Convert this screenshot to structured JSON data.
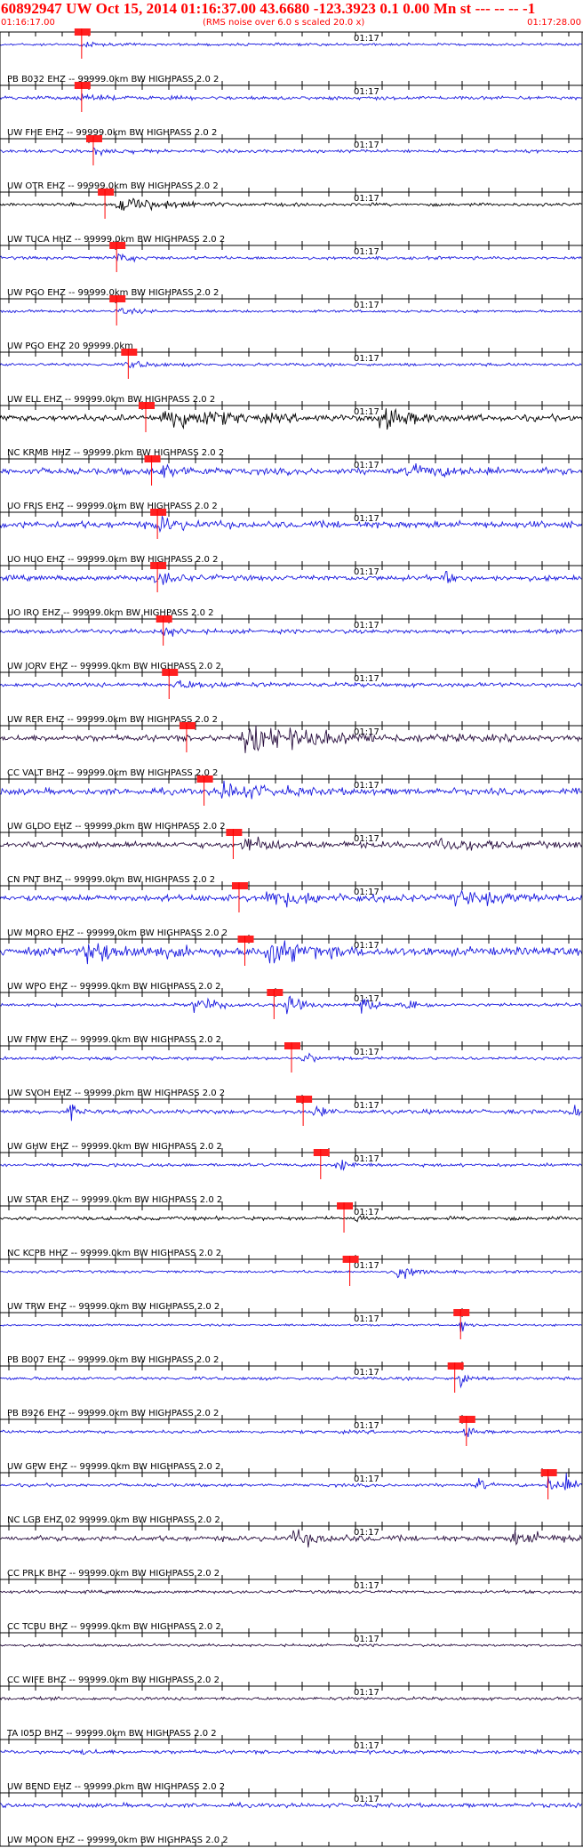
{
  "header": {
    "title": "60892947 UW Oct 15, 2014 01:16:37.00   43.6680 -123.3923  0.1 0.00 Mn st --- -- --  -1",
    "start_time": "01:16:17.00",
    "noise_note": "(RMS noise over 6.0 s scaled 20.0 x)",
    "end_time": "01:17:28.00"
  },
  "colors": {
    "blue": "#1a1adf",
    "black": "#000000",
    "dark": "#2a1040",
    "red": "#ff0000",
    "pick_box": "#ff2020",
    "axis": "#000000"
  },
  "chart_data": {
    "type": "line",
    "title": "60892947 UW Oct 15, 2014 01:16:37.00",
    "x_start": "01:16:17.00",
    "x_end": "01:17:28.00",
    "minute_label": "01:17",
    "traces": [
      {
        "label": "PB B032 EHZ -- 99999.0km BW  HIGHPASS  2.0  2",
        "color": "blue",
        "amp": 0.25,
        "pick": 0.14,
        "events": [
          [
            0.14,
            0.5,
            0.02
          ]
        ]
      },
      {
        "label": "UW FHE EHZ -- 99999.0km BW  HIGHPASS  2.0  2",
        "color": "blue",
        "amp": 0.35,
        "pick": 0.14,
        "events": [
          [
            0.14,
            0.6,
            0.03
          ]
        ]
      },
      {
        "label": "UW OTR EHZ -- 99999.0km BW  HIGHPASS  2.0  2",
        "color": "blue",
        "amp": 0.3,
        "pick": 0.16,
        "events": [
          [
            0.16,
            0.7,
            0.04
          ]
        ]
      },
      {
        "label": "UW TUCA HHZ -- 99999.0km BW  HIGHPASS  2.0  2",
        "color": "black",
        "amp": 0.3,
        "pick": 0.18,
        "events": [
          [
            0.2,
            1.4,
            0.08
          ]
        ]
      },
      {
        "label": "UW PGO EHZ -- 99999.0km BW  HIGHPASS  2.0  2",
        "color": "blue",
        "amp": 0.3,
        "pick": 0.2,
        "events": [
          [
            0.2,
            0.8,
            0.03
          ]
        ]
      },
      {
        "label": "UW PGO EHZ 20 99999.0km",
        "color": "blue",
        "amp": 0.25,
        "pick": 0.2,
        "events": [
          [
            0.2,
            0.6,
            0.03
          ]
        ]
      },
      {
        "label": "UW ELL EHZ -- 99999.0km BW  HIGHPASS  2.0  2",
        "color": "blue",
        "amp": 0.3,
        "pick": 0.22,
        "events": [
          [
            0.22,
            0.8,
            0.03
          ]
        ]
      },
      {
        "label": "NC KRMB HHZ -- 99999.0km BW  HIGHPASS  2.0  2",
        "color": "black",
        "amp": 0.6,
        "pick": 0.25,
        "events": [
          [
            0.28,
            2.6,
            0.08
          ],
          [
            0.65,
            2.0,
            0.05
          ]
        ]
      },
      {
        "label": "UO FRIS EHZ -- 99999.0km BW  HIGHPASS  2.0  2",
        "color": "blue",
        "amp": 0.6,
        "pick": 0.26,
        "events": [
          [
            0.27,
            1.4,
            0.04
          ],
          [
            0.7,
            0.8,
            0.1
          ]
        ]
      },
      {
        "label": "UO HUO EHZ -- 99999.0km BW  HIGHPASS  2.0  2",
        "color": "blue",
        "amp": 0.65,
        "pick": 0.27,
        "events": [
          [
            0.27,
            1.6,
            0.03
          ]
        ]
      },
      {
        "label": "UO IRO EHZ -- 99999.0km BW  HIGHPASS  2.0  2",
        "color": "blue",
        "amp": 0.5,
        "pick": 0.27,
        "events": [
          [
            0.27,
            1.5,
            0.03
          ],
          [
            0.76,
            1.5,
            0.01
          ]
        ]
      },
      {
        "label": "UW JORV EHZ -- 99999.0km BW  HIGHPASS  2.0  2",
        "color": "blue",
        "amp": 0.4,
        "pick": 0.28,
        "events": [
          [
            0.28,
            0.9,
            0.03
          ]
        ]
      },
      {
        "label": "UW RER EHZ -- 99999.0km BW  HIGHPASS  2.0  2",
        "color": "blue",
        "amp": 0.4,
        "pick": 0.29,
        "events": [
          [
            0.3,
            0.8,
            0.05
          ]
        ]
      },
      {
        "label": "CC VALT BHZ -- 99999.0km BW  HIGHPASS  2.0  2",
        "color": "dark",
        "amp": 0.6,
        "pick": 0.32,
        "events": [
          [
            0.42,
            2.6,
            0.12
          ]
        ]
      },
      {
        "label": "UW GLDO EHZ -- 99999.0km BW  HIGHPASS  2.0  2",
        "color": "blue",
        "amp": 0.6,
        "pick": 0.35,
        "events": [
          [
            0.38,
            1.5,
            0.08
          ]
        ]
      },
      {
        "label": "CN PNT BHZ -- 99999.0km BW  HIGHPASS  2.0  2",
        "color": "dark",
        "amp": 0.6,
        "pick": 0.4,
        "events": [
          [
            0.42,
            1.5,
            0.04
          ],
          [
            0.75,
            1.3,
            0.06
          ]
        ]
      },
      {
        "label": "UW MORO EHZ -- 99999.0km BW  HIGHPASS  2.0  2",
        "color": "blue",
        "amp": 0.6,
        "pick": 0.41,
        "events": [
          [
            0.45,
            1.6,
            0.08
          ],
          [
            0.78,
            1.2,
            0.08
          ]
        ]
      },
      {
        "label": "UW WPO EHZ -- 99999.0km BW  HIGHPASS  2.0  2",
        "color": "blue",
        "amp": 0.8,
        "pick": 0.42,
        "events": [
          [
            0.15,
            1.8,
            0.08
          ],
          [
            0.46,
            2.2,
            0.06
          ]
        ]
      },
      {
        "label": "UW FMW EHZ -- 99999.0km BW  HIGHPASS  2.0  2",
        "color": "blue",
        "amp": 0.3,
        "pick": 0.47,
        "events": [
          [
            0.33,
            1.5,
            0.04
          ],
          [
            0.49,
            2.2,
            0.02
          ],
          [
            0.62,
            2.2,
            0.02
          ],
          [
            0.7,
            1.6,
            0.02
          ]
        ]
      },
      {
        "label": "UW SVOH EHZ -- 99999.0km BW  HIGHPASS  2.0  2",
        "color": "blue",
        "amp": 0.3,
        "pick": 0.5,
        "events": [
          [
            0.52,
            1.1,
            0.02
          ]
        ]
      },
      {
        "label": "UW GHW EHZ -- 99999.0km BW  HIGHPASS  2.0  2",
        "color": "blue",
        "amp": 0.4,
        "pick": 0.52,
        "events": [
          [
            0.12,
            1.4,
            0.01
          ],
          [
            0.54,
            2.2,
            0.01
          ],
          [
            0.98,
            1.4,
            0.02
          ]
        ]
      },
      {
        "label": "UW STAR EHZ -- 99999.0km BW  HIGHPASS  2.0  2",
        "color": "blue",
        "amp": 0.3,
        "pick": 0.55,
        "events": [
          [
            0.58,
            1.4,
            0.02
          ]
        ]
      },
      {
        "label": "NC KCPB HHZ -- 99999.0km BW  HIGHPASS  2.0  2",
        "color": "black",
        "amp": 0.35,
        "pick": 0.59,
        "events": [
          [
            0.61,
            0.8,
            0.01
          ]
        ]
      },
      {
        "label": "UW TRW EHZ -- 99999.0km BW  HIGHPASS  2.0  2",
        "color": "blue",
        "amp": 0.25,
        "pick": 0.6,
        "events": [
          [
            0.68,
            1.6,
            0.03
          ]
        ]
      },
      {
        "label": "PB B007 EHZ -- 99999.0km BW  HIGHPASS  2.0  2",
        "color": "blue",
        "amp": 0.2,
        "pick": 0.79,
        "events": [
          [
            0.79,
            1.6,
            0.01
          ]
        ]
      },
      {
        "label": "PB B926 EHZ -- 99999.0km BW  HIGHPASS  2.0  2",
        "color": "blue",
        "amp": 0.3,
        "pick": 0.78,
        "events": [
          [
            0.79,
            2.2,
            0.01
          ]
        ]
      },
      {
        "label": "UW GPW EHZ -- 99999.0km BW  HIGHPASS  2.0  2",
        "color": "blue",
        "amp": 0.3,
        "pick": 0.8,
        "events": [
          [
            0.8,
            1.2,
            0.01
          ]
        ]
      },
      {
        "label": "NC LGB EHZ 02 99999.0km BW  HIGHPASS  2.0  2",
        "color": "blue",
        "amp": 0.3,
        "pick": 0.94,
        "events": [
          [
            0.82,
            1.5,
            0.01
          ],
          [
            0.94,
            2.0,
            0.02
          ],
          [
            0.97,
            1.8,
            0.01
          ]
        ]
      },
      {
        "label": "CC PRLK BHZ -- 99999.0km BW  HIGHPASS  2.0  2",
        "color": "dark",
        "amp": 0.5,
        "pick": null,
        "events": [
          [
            0.5,
            1.4,
            0.05
          ],
          [
            0.88,
            1.4,
            0.06
          ]
        ]
      },
      {
        "label": "CC TCBU BHZ -- 99999.0km BW  HIGHPASS  2.0  2",
        "color": "dark",
        "amp": 0.3,
        "pick": null,
        "events": []
      },
      {
        "label": "CC WIFE BHZ -- 99999.0km BW  HIGHPASS  2.0  2",
        "color": "dark",
        "amp": 0.25,
        "pick": null,
        "events": []
      },
      {
        "label": "TA I05D BHZ -- 99999.0km BW  HIGHPASS  2.0  2",
        "color": "dark",
        "amp": 0.3,
        "pick": null,
        "events": []
      },
      {
        "label": "UW BEND EHZ -- 99999.0km BW  HIGHPASS  2.0  2",
        "color": "blue",
        "amp": 0.35,
        "pick": null,
        "events": [
          [
            0.14,
            0.6,
            0.02
          ]
        ]
      },
      {
        "label": "UW MOON EHZ -- 99999.0km BW  HIGHPASS  2.0  2",
        "color": "blue",
        "amp": 0.4,
        "pick": null,
        "events": []
      }
    ]
  }
}
